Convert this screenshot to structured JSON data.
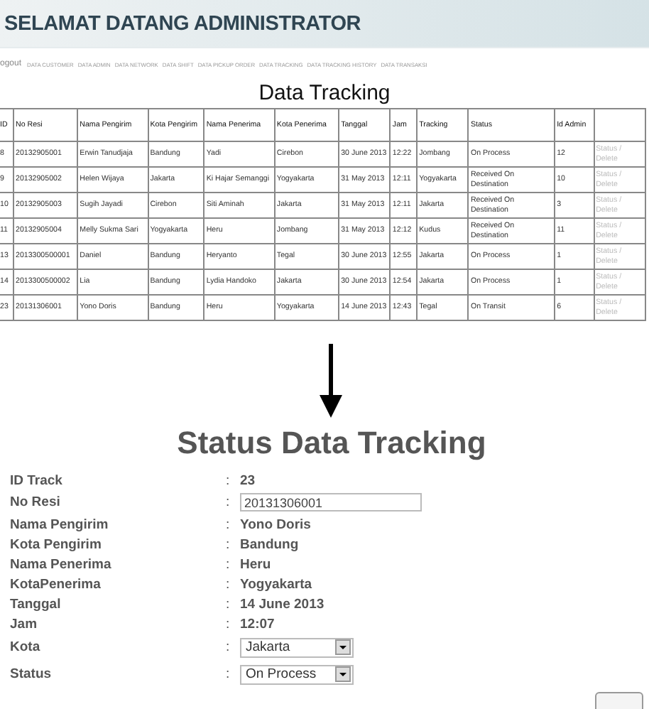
{
  "header": {
    "title": "SELAMAT DATANG ADMINISTRATOR"
  },
  "nav": [
    "ogout",
    "DATA CUSTOMER",
    "DATA ADMIN",
    "DATA NETWORK",
    "DATA SHIFT",
    "DATA PICKUP ORDER",
    "DATA TRACKING",
    "DATA TRACKING HISTORY",
    "DATA TRANSAKSI"
  ],
  "table": {
    "title": "Data Tracking",
    "columns": [
      "ID",
      "No Resi",
      "Nama Pengirim",
      "Kota Pengirim",
      "Nama Penerima",
      "Kota Penerima",
      "Tanggal",
      "Jam",
      "Tracking",
      "Status",
      "Id Admin"
    ],
    "rows": [
      {
        "cells": [
          "8",
          "20132905001",
          "Erwin Tanudjaja",
          "Bandung",
          "Yadi",
          "Cirebon",
          "30 June 2013",
          "12:22",
          "Jombang",
          "On Process",
          "12"
        ],
        "action": "Status / Delete"
      },
      {
        "cells": [
          "9",
          "20132905002",
          "Helen Wijaya",
          "Jakarta",
          "Ki Hajar Semanggi",
          "Yogyakarta",
          "31 May 2013",
          "12:11",
          "Yogyakarta",
          "Received On Destination",
          "10"
        ],
        "action": "Status / Delete"
      },
      {
        "cells": [
          "10",
          "20132905003",
          "Sugih Jayadi",
          "Cirebon",
          "Siti Aminah",
          "Jakarta",
          "31 May 2013",
          "12:11",
          "Jakarta",
          "Received On Destination",
          "3"
        ],
        "action": "Status / Delete"
      },
      {
        "cells": [
          "11",
          "20132905004",
          "Melly Sukma Sari",
          "Yogyakarta",
          "Heru",
          "Jombang",
          "31 May 2013",
          "12:12",
          "Kudus",
          "Received On Destination",
          "11"
        ],
        "action": "Status / Delete"
      },
      {
        "cells": [
          "13",
          "2013300500001",
          "Daniel",
          "Bandung",
          "Heryanto",
          "Tegal",
          "30 June 2013",
          "12:55",
          "Jakarta",
          "On Process",
          "1"
        ],
        "action": "Status / Delete"
      },
      {
        "cells": [
          "14",
          "2013300500002",
          "Lia",
          "Bandung",
          "Lydia Handoko",
          "Jakarta",
          "30 June 2013",
          "12:54",
          "Jakarta",
          "On Process",
          "1"
        ],
        "action": "Status / Delete"
      },
      {
        "cells": [
          "23",
          "20131306001",
          "Yono Doris",
          "Bandung",
          "Heru",
          "Yogyakarta",
          "14 June 2013",
          "12:43",
          "Tegal",
          "On Transit",
          "6"
        ],
        "action": "Status / Delete"
      }
    ]
  },
  "form": {
    "title": "Status Data Tracking",
    "fields": [
      {
        "kind": "text",
        "label": "ID Track",
        "colon": ":",
        "value": "23"
      },
      {
        "kind": "input",
        "label": "No Resi",
        "colon": ":",
        "value": "20131306001"
      },
      {
        "kind": "text",
        "label": "Nama Pengirim",
        "colon": ":",
        "value": "Yono Doris"
      },
      {
        "kind": "text",
        "label": "Kota Pengirim",
        "colon": ":",
        "value": "Bandung"
      },
      {
        "kind": "text",
        "label": "Nama Penerima",
        "colon": ":",
        "value": "Heru"
      },
      {
        "kind": "text",
        "label": "KotaPenerima",
        "colon": ":",
        "value": "Yogyakarta"
      },
      {
        "kind": "text",
        "label": "Tanggal",
        "colon": ":",
        "value": "14 June 2013"
      },
      {
        "kind": "text",
        "label": "Jam",
        "colon": ":",
        "value": "12:07"
      },
      {
        "kind": "select",
        "label": "Kota",
        "colon": ":",
        "value": "Jakarta"
      },
      {
        "kind": "select",
        "label": "Status",
        "colon": ":",
        "value": "On Process"
      }
    ]
  }
}
